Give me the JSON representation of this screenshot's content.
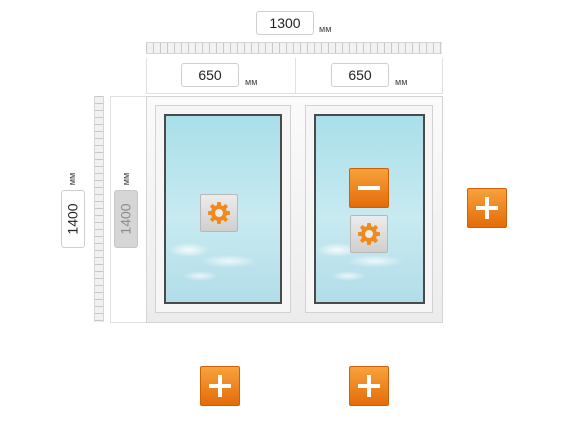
{
  "dimensions": {
    "total_width": {
      "value": "1300",
      "unit": "мм"
    },
    "left_sash_width": {
      "value": "650",
      "unit": "мм"
    },
    "right_sash_width": {
      "value": "650",
      "unit": "мм"
    },
    "total_height": {
      "value": "1400",
      "unit": "мм"
    },
    "sash_height": {
      "value": "1400",
      "unit": "мм"
    }
  },
  "icons": {
    "settings": "gear-icon",
    "add": "plus-icon",
    "remove": "minus-icon"
  },
  "colors": {
    "accent_orange": "#f08a1c",
    "glass": "#bfe6ee",
    "frame": "#f2f2f2"
  }
}
